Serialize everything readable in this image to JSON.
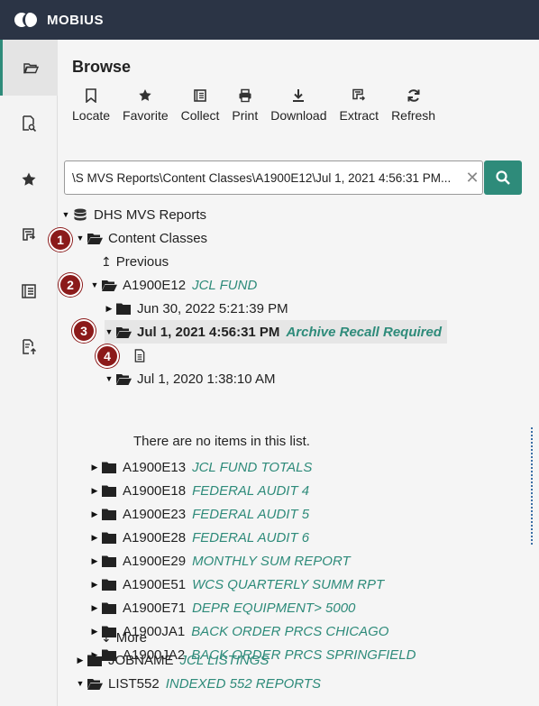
{
  "app": {
    "title": "MOBIUS",
    "logo": "mobius-logo"
  },
  "rail": {
    "items": [
      {
        "icon": "folder-open-icon",
        "active": true
      },
      {
        "icon": "document-search-icon",
        "active": false
      },
      {
        "icon": "star-icon",
        "active": false
      },
      {
        "icon": "extract-icon",
        "active": false
      },
      {
        "icon": "collection-icon",
        "active": false
      },
      {
        "icon": "upload-document-icon",
        "active": false
      }
    ]
  },
  "browse": {
    "title": "Browse",
    "toolbar": [
      {
        "label": "Locate",
        "icon": "bookmark-icon"
      },
      {
        "label": "Favorite",
        "icon": "star-icon"
      },
      {
        "label": "Collect",
        "icon": "collect-icon"
      },
      {
        "label": "Print",
        "icon": "printer-icon"
      },
      {
        "label": "Download",
        "icon": "download-icon"
      },
      {
        "label": "Extract",
        "icon": "extract-icon"
      },
      {
        "label": "Refresh",
        "icon": "refresh-icon"
      }
    ]
  },
  "search": {
    "value": "...S MVS Reports\\Content Classes\\A1900E12\\Jul 1, 2021 4:56:31 PM\\"
  },
  "tree": {
    "root": "DHS MVS Reports",
    "content_classes": "Content Classes",
    "previous": "Previous",
    "a1900e12": {
      "name": "A1900E12",
      "desc": "JCL FUND"
    },
    "v_jun": "Jun 30, 2022 5:21:39 PM",
    "v_jul21": {
      "name": "Jul 1, 2021 4:56:31 PM",
      "desc": "Archive Recall Required"
    },
    "v_jul20": "Jul 1, 2020 1:38:10 AM",
    "empty": "There are no items in this list.",
    "classes": [
      {
        "name": "A1900E13",
        "desc": "JCL FUND TOTALS"
      },
      {
        "name": "A1900E18",
        "desc": "FEDERAL AUDIT 4"
      },
      {
        "name": "A1900E23",
        "desc": "FEDERAL AUDIT 5"
      },
      {
        "name": "A1900E28",
        "desc": "FEDERAL AUDIT 6"
      },
      {
        "name": "A1900E29",
        "desc": "MONTHLY SUM REPORT"
      },
      {
        "name": "A1900E51",
        "desc": "WCS QUARTERLY SUMM RPT"
      },
      {
        "name": "A1900E71",
        "desc": "DEPR EQUIPMENT> 5000"
      },
      {
        "name": "A1900JA1",
        "desc": "BACK ORDER PRCS CHICAGO"
      },
      {
        "name": "A1900JA2",
        "desc": "BACK ORDER PRCS SPRINGFIELD"
      }
    ],
    "more": "More",
    "jobname": {
      "name": "JOBNAME",
      "desc": "JCL LISTINGS"
    },
    "list552": {
      "name": "LIST552",
      "desc": "INDEXED 552 REPORTS"
    }
  },
  "callouts": [
    "1",
    "2",
    "3",
    "4"
  ],
  "colors": {
    "accent": "#2e8b7a",
    "topbar": "#2b3445",
    "callout": "#8b1a1a"
  }
}
